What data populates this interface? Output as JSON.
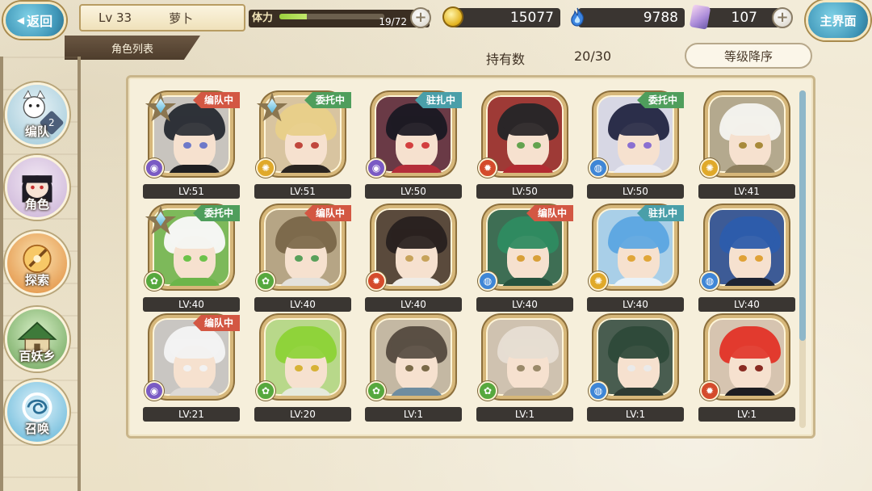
{
  "header": {
    "back_label": "返回",
    "level": "Lv 33",
    "player_name": "萝卜",
    "tab_title": "角色列表",
    "stamina_label": "体力",
    "stamina_value": "19/72",
    "stamina_fraction": 0.264,
    "gold": "15077",
    "soul": "9788",
    "gem": "107",
    "home_label": "主界面"
  },
  "toolbar": {
    "owned_label": "持有数",
    "owned_value": "20/30",
    "sort_label": "等级降序"
  },
  "sidebar": {
    "items": [
      {
        "label": "编队",
        "badge": "2"
      },
      {
        "label": "角色"
      },
      {
        "label": "探索"
      },
      {
        "label": "百妖乡"
      },
      {
        "label": "召唤"
      }
    ]
  },
  "colors": {
    "tag_red": "#d35743",
    "tag_green": "#4f9e5c",
    "tag_teal": "#4a9fa9",
    "accent_blue": "#3f96b8"
  },
  "characters": [
    {
      "level": "LV:51",
      "tag": "编队中",
      "tag_color": "red",
      "star": true,
      "element": "purple",
      "hair": "#2e3238",
      "eye": "#6d79c9",
      "bg": "#c8c4be",
      "collar": "#1f1f22"
    },
    {
      "level": "LV:51",
      "tag": "委托中",
      "tag_color": "green",
      "star": true,
      "element": "gold",
      "hair": "#e8cf8a",
      "eye": "#c0473c",
      "bg": "#d8c4a0",
      "collar": "#2a2420"
    },
    {
      "level": "LV:50",
      "tag": "驻扎中",
      "tag_color": "teal",
      "star": false,
      "element": "purple",
      "hair": "#1e1a24",
      "eye": "#d33f3f",
      "bg": "#6a3a46",
      "collar": "#b52e3a"
    },
    {
      "level": "LV:50",
      "tag": "",
      "tag_color": "",
      "star": false,
      "element": "red",
      "hair": "#2a2628",
      "eye": "#63a34f",
      "bg": "#9e3a36",
      "collar": "#b32b32"
    },
    {
      "level": "LV:50",
      "tag": "委托中",
      "tag_color": "green",
      "star": false,
      "element": "blue",
      "hair": "#2b2e4a",
      "eye": "#8a6fd1",
      "bg": "#d7d7e4",
      "collar": "#ececf3"
    },
    {
      "level": "LV:41",
      "tag": "",
      "tag_color": "",
      "star": false,
      "element": "gold",
      "hair": "#f2f1ec",
      "eye": "#a88a3a",
      "bg": "#b4a98e",
      "collar": "#8d7f5e"
    },
    {
      "level": "LV:40",
      "tag": "委托中",
      "tag_color": "green",
      "star": true,
      "element": "green",
      "hair": "#f4f6f2",
      "eye": "#6cc24a",
      "bg": "#7db95a",
      "collar": "#6cb54a"
    },
    {
      "level": "LV:40",
      "tag": "编队中",
      "tag_color": "red",
      "star": false,
      "element": "green",
      "hair": "#7d6a4c",
      "eye": "#58a05a",
      "bg": "#b6a585",
      "collar": "#e4e1db"
    },
    {
      "level": "LV:40",
      "tag": "",
      "tag_color": "",
      "star": false,
      "element": "red",
      "hair": "#2a2220",
      "eye": "#c7a35a",
      "bg": "#5a4a3c",
      "collar": "#efece6"
    },
    {
      "level": "LV:40",
      "tag": "编队中",
      "tag_color": "red",
      "star": false,
      "element": "blue",
      "hair": "#2f8a60",
      "eye": "#d8a038",
      "bg": "#3e6e54",
      "collar": "#27523e"
    },
    {
      "level": "LV:40",
      "tag": "驻扎中",
      "tag_color": "teal",
      "star": false,
      "element": "gold",
      "hair": "#5fa8e2",
      "eye": "#e0a638",
      "bg": "#a9cfe8",
      "collar": "#e9f2f8"
    },
    {
      "level": "LV:40",
      "tag": "",
      "tag_color": "",
      "star": false,
      "element": "blue",
      "hair": "#2d5cab",
      "eye": "#e0a236",
      "bg": "#3d5b96",
      "collar": "#1e2433"
    },
    {
      "level": "LV:21",
      "tag": "编队中",
      "tag_color": "red",
      "star": false,
      "element": "purple",
      "hair": "#f2f2f2",
      "eye": "#f2f2f2",
      "bg": "#c9c6c2",
      "collar": "#ddd9d5"
    },
    {
      "level": "LV:20",
      "tag": "",
      "tag_color": "",
      "star": false,
      "element": "green",
      "hair": "#8fd33a",
      "eye": "#d7b236",
      "bg": "#b8d88a",
      "collar": "#e6eadc"
    },
    {
      "level": "LV:1",
      "tag": "",
      "tag_color": "",
      "star": false,
      "element": "green",
      "hair": "#5a4f44",
      "eye": "#7a6a48",
      "bg": "#c4b8a3",
      "collar": "#6f8da0"
    },
    {
      "level": "LV:1",
      "tag": "",
      "tag_color": "",
      "star": false,
      "element": "green",
      "hair": "#e6ddd2",
      "eye": "#9a8a6a",
      "bg": "#cfc2b0",
      "collar": "#b9ac98"
    },
    {
      "level": "LV:1",
      "tag": "",
      "tag_color": "",
      "star": false,
      "element": "blue",
      "hair": "#2f4a3a",
      "eye": "#eaeaea",
      "bg": "#495d50",
      "collar": "#2e3b33"
    },
    {
      "level": "LV:1",
      "tag": "",
      "tag_color": "",
      "star": false,
      "element": "red",
      "hair": "#e23a2e",
      "eye": "#8a2a22",
      "bg": "#d6c4b0",
      "collar": "#1e1e22"
    }
  ]
}
